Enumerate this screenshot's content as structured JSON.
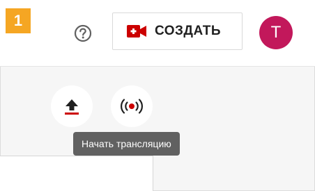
{
  "step_badge": "1",
  "header": {
    "create_label": "СОЗДАТЬ",
    "avatar_initial": "T"
  },
  "icons": {
    "help": "help-circle-icon",
    "create": "video-camera-add-icon",
    "upload": "upload-icon",
    "live": "live-broadcast-icon"
  },
  "tooltip": "Начать трансляцию",
  "colors": {
    "badge": "#f5a623",
    "brand_red": "#cc0000",
    "avatar": "#c2185b",
    "tooltip_bg": "#616161"
  }
}
